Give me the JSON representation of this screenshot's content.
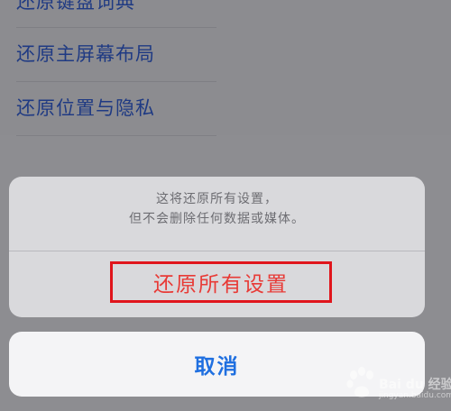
{
  "background_list": {
    "items": [
      {
        "label": "还原键盘词典"
      },
      {
        "label": "还原主屏幕布局"
      },
      {
        "label": "还原位置与隐私"
      }
    ]
  },
  "action_sheet": {
    "message_line1": "这将还原所有设置，",
    "message_line2": "但不会删除任何数据或媒体。",
    "destructive_label": "还原所有设置",
    "cancel_label": "取消"
  },
  "colors": {
    "destructive": "#e83a36",
    "highlight_box": "#e0151c",
    "cancel": "#1f6fe0"
  },
  "watermark": {
    "icon": "baidu-paw-logo",
    "text": "Bai du 经验",
    "subtext": "jingyan.baidu.com"
  }
}
